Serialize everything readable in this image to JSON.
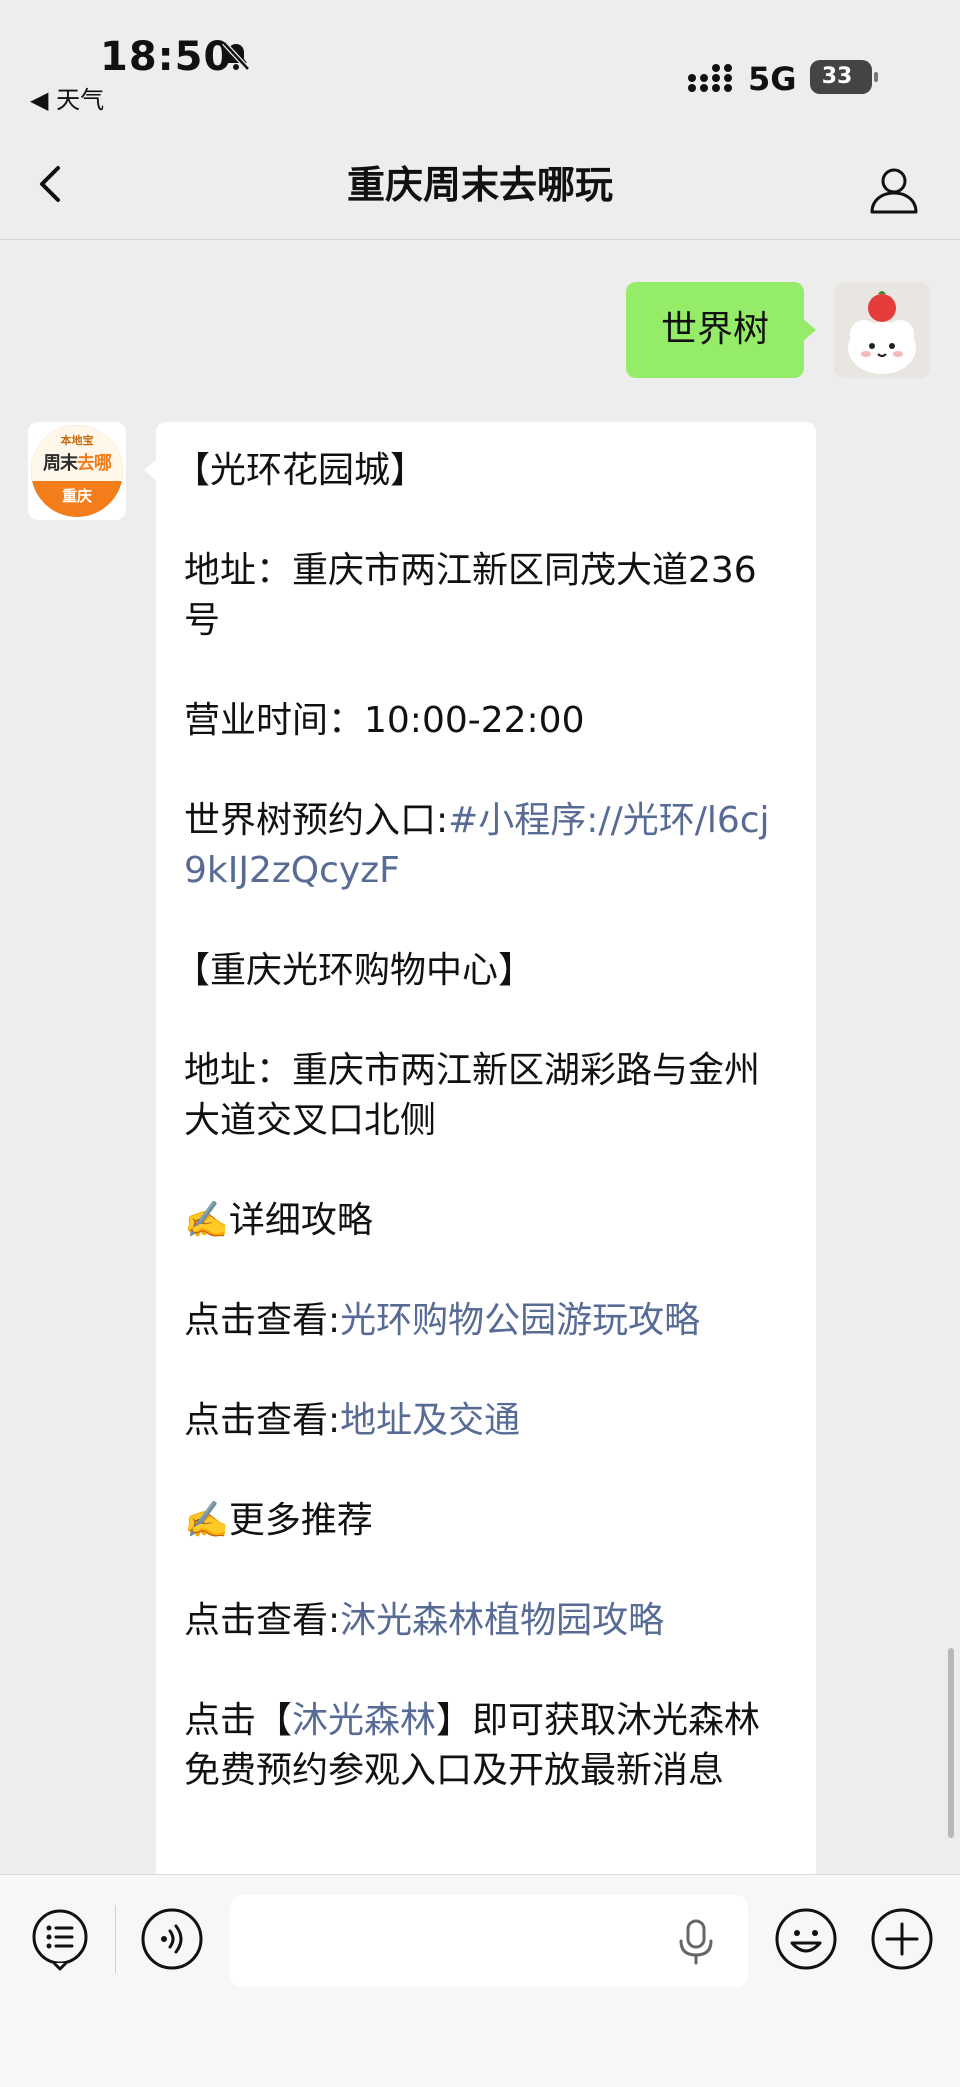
{
  "status": {
    "time": "18:50",
    "back_app": "◀ 天气",
    "network": "5G",
    "battery": "33"
  },
  "nav": {
    "title": "重庆周末去哪玩"
  },
  "outgoing": {
    "text": "世界树"
  },
  "bot_avatar": {
    "sub": "本地宝",
    "main_a": "周末",
    "main_b": "去哪",
    "city": "重庆"
  },
  "message": {
    "title1": "【光环花园城】",
    "addr1": "地址：重庆市两江新区同茂大道236号",
    "hours": "营业时间：10:00-22:00",
    "booking_label": "世界树预约入口:",
    "booking_link": "#小程序://光环/l6cj9kIJ2zQcyzF",
    "title2": "【重庆光环购物中心】",
    "addr2": "地址：重庆市两江新区湖彩路与金州大道交叉口北侧",
    "guide_heading": "✍️详细攻略",
    "click_label": "点击查看:",
    "link_guide": "光环购物公园游玩攻略",
    "link_traffic": "地址及交通",
    "more_heading": "✍️更多推荐",
    "link_forest": "沐光森林植物园攻略",
    "click_prefix": "点击【",
    "forest_name": "沐光森林",
    "click_suffix": "】即可获取沐光森林免费预约参观入口及开放最新消息"
  },
  "input": {
    "value": "",
    "placeholder": ""
  }
}
